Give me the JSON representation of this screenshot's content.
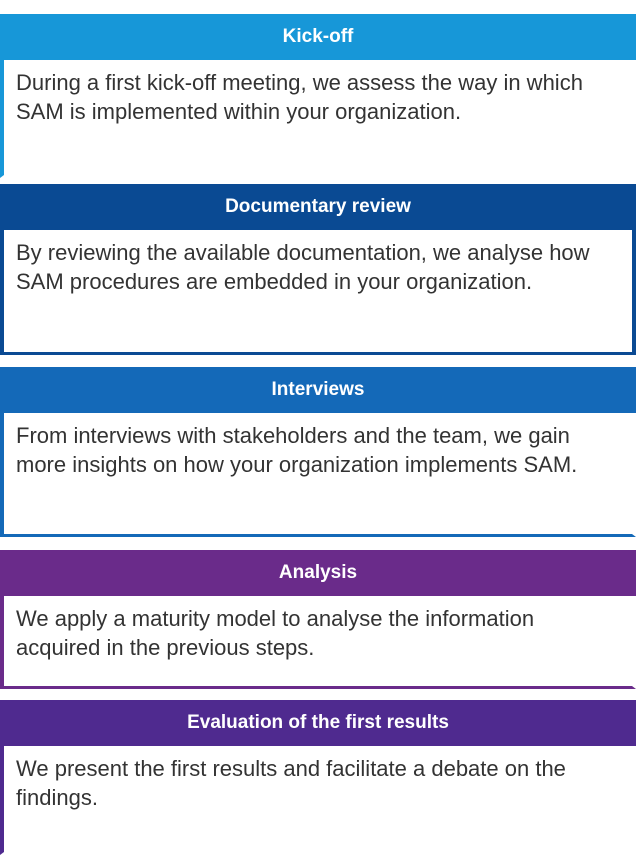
{
  "steps": [
    {
      "title": "Kick-off",
      "text": "During a first kick-off meeting, we assess the way in which SAM is implemented within your organization.",
      "color": "#1797d8"
    },
    {
      "title": "Documentary review",
      "text": "By reviewing the available documentation, we analyse how SAM procedures are embedded in your organization.",
      "color": "#0a4a93"
    },
    {
      "title": "Interviews",
      "text": "From interviews with stakeholders and the team, we gain more insights on how your organization implements SAM.",
      "color": "#1469b8"
    },
    {
      "title": "Analysis",
      "text": "We apply a maturity model to analyse the information acquired in the previous steps.",
      "color": "#6a2b8a"
    },
    {
      "title": "Evaluation of the first results",
      "text": "We present the first results and facilitate a debate on the findings.",
      "color": "#4f2a8f"
    }
  ]
}
